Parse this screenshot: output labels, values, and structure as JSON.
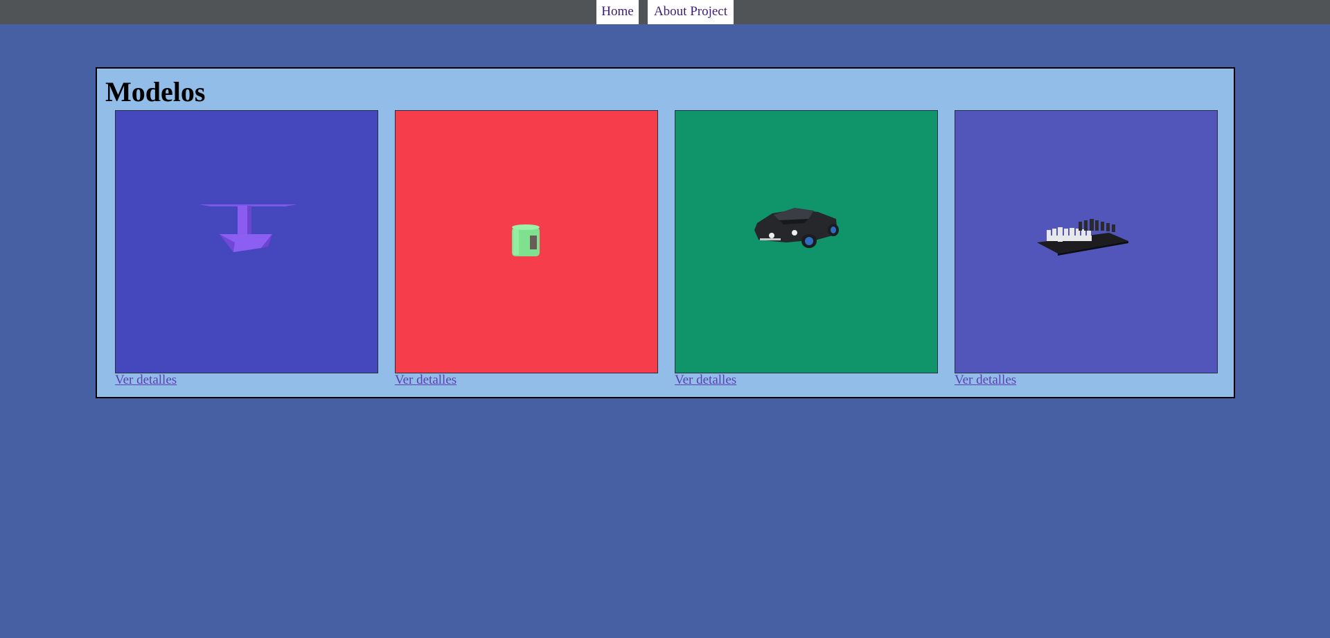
{
  "nav": {
    "home_label": "Home",
    "about_label": "About Project"
  },
  "main": {
    "title": "Modelos",
    "models": [
      {
        "link_label": "Ver detalles",
        "background": "#4547bd",
        "icon": "table-model-icon"
      },
      {
        "link_label": "Ver detalles",
        "background": "#f53d4b",
        "icon": "mug-model-icon"
      },
      {
        "link_label": "Ver detalles",
        "background": "#10946a",
        "icon": "car-model-icon"
      },
      {
        "link_label": "Ver detalles",
        "background": "#5255b9",
        "icon": "chess-board-model-icon"
      }
    ]
  },
  "colors": {
    "page_background": "#4760a3",
    "nav_bar": "#505457",
    "panel_background": "#93bde9",
    "link": "#5b3fb0"
  }
}
